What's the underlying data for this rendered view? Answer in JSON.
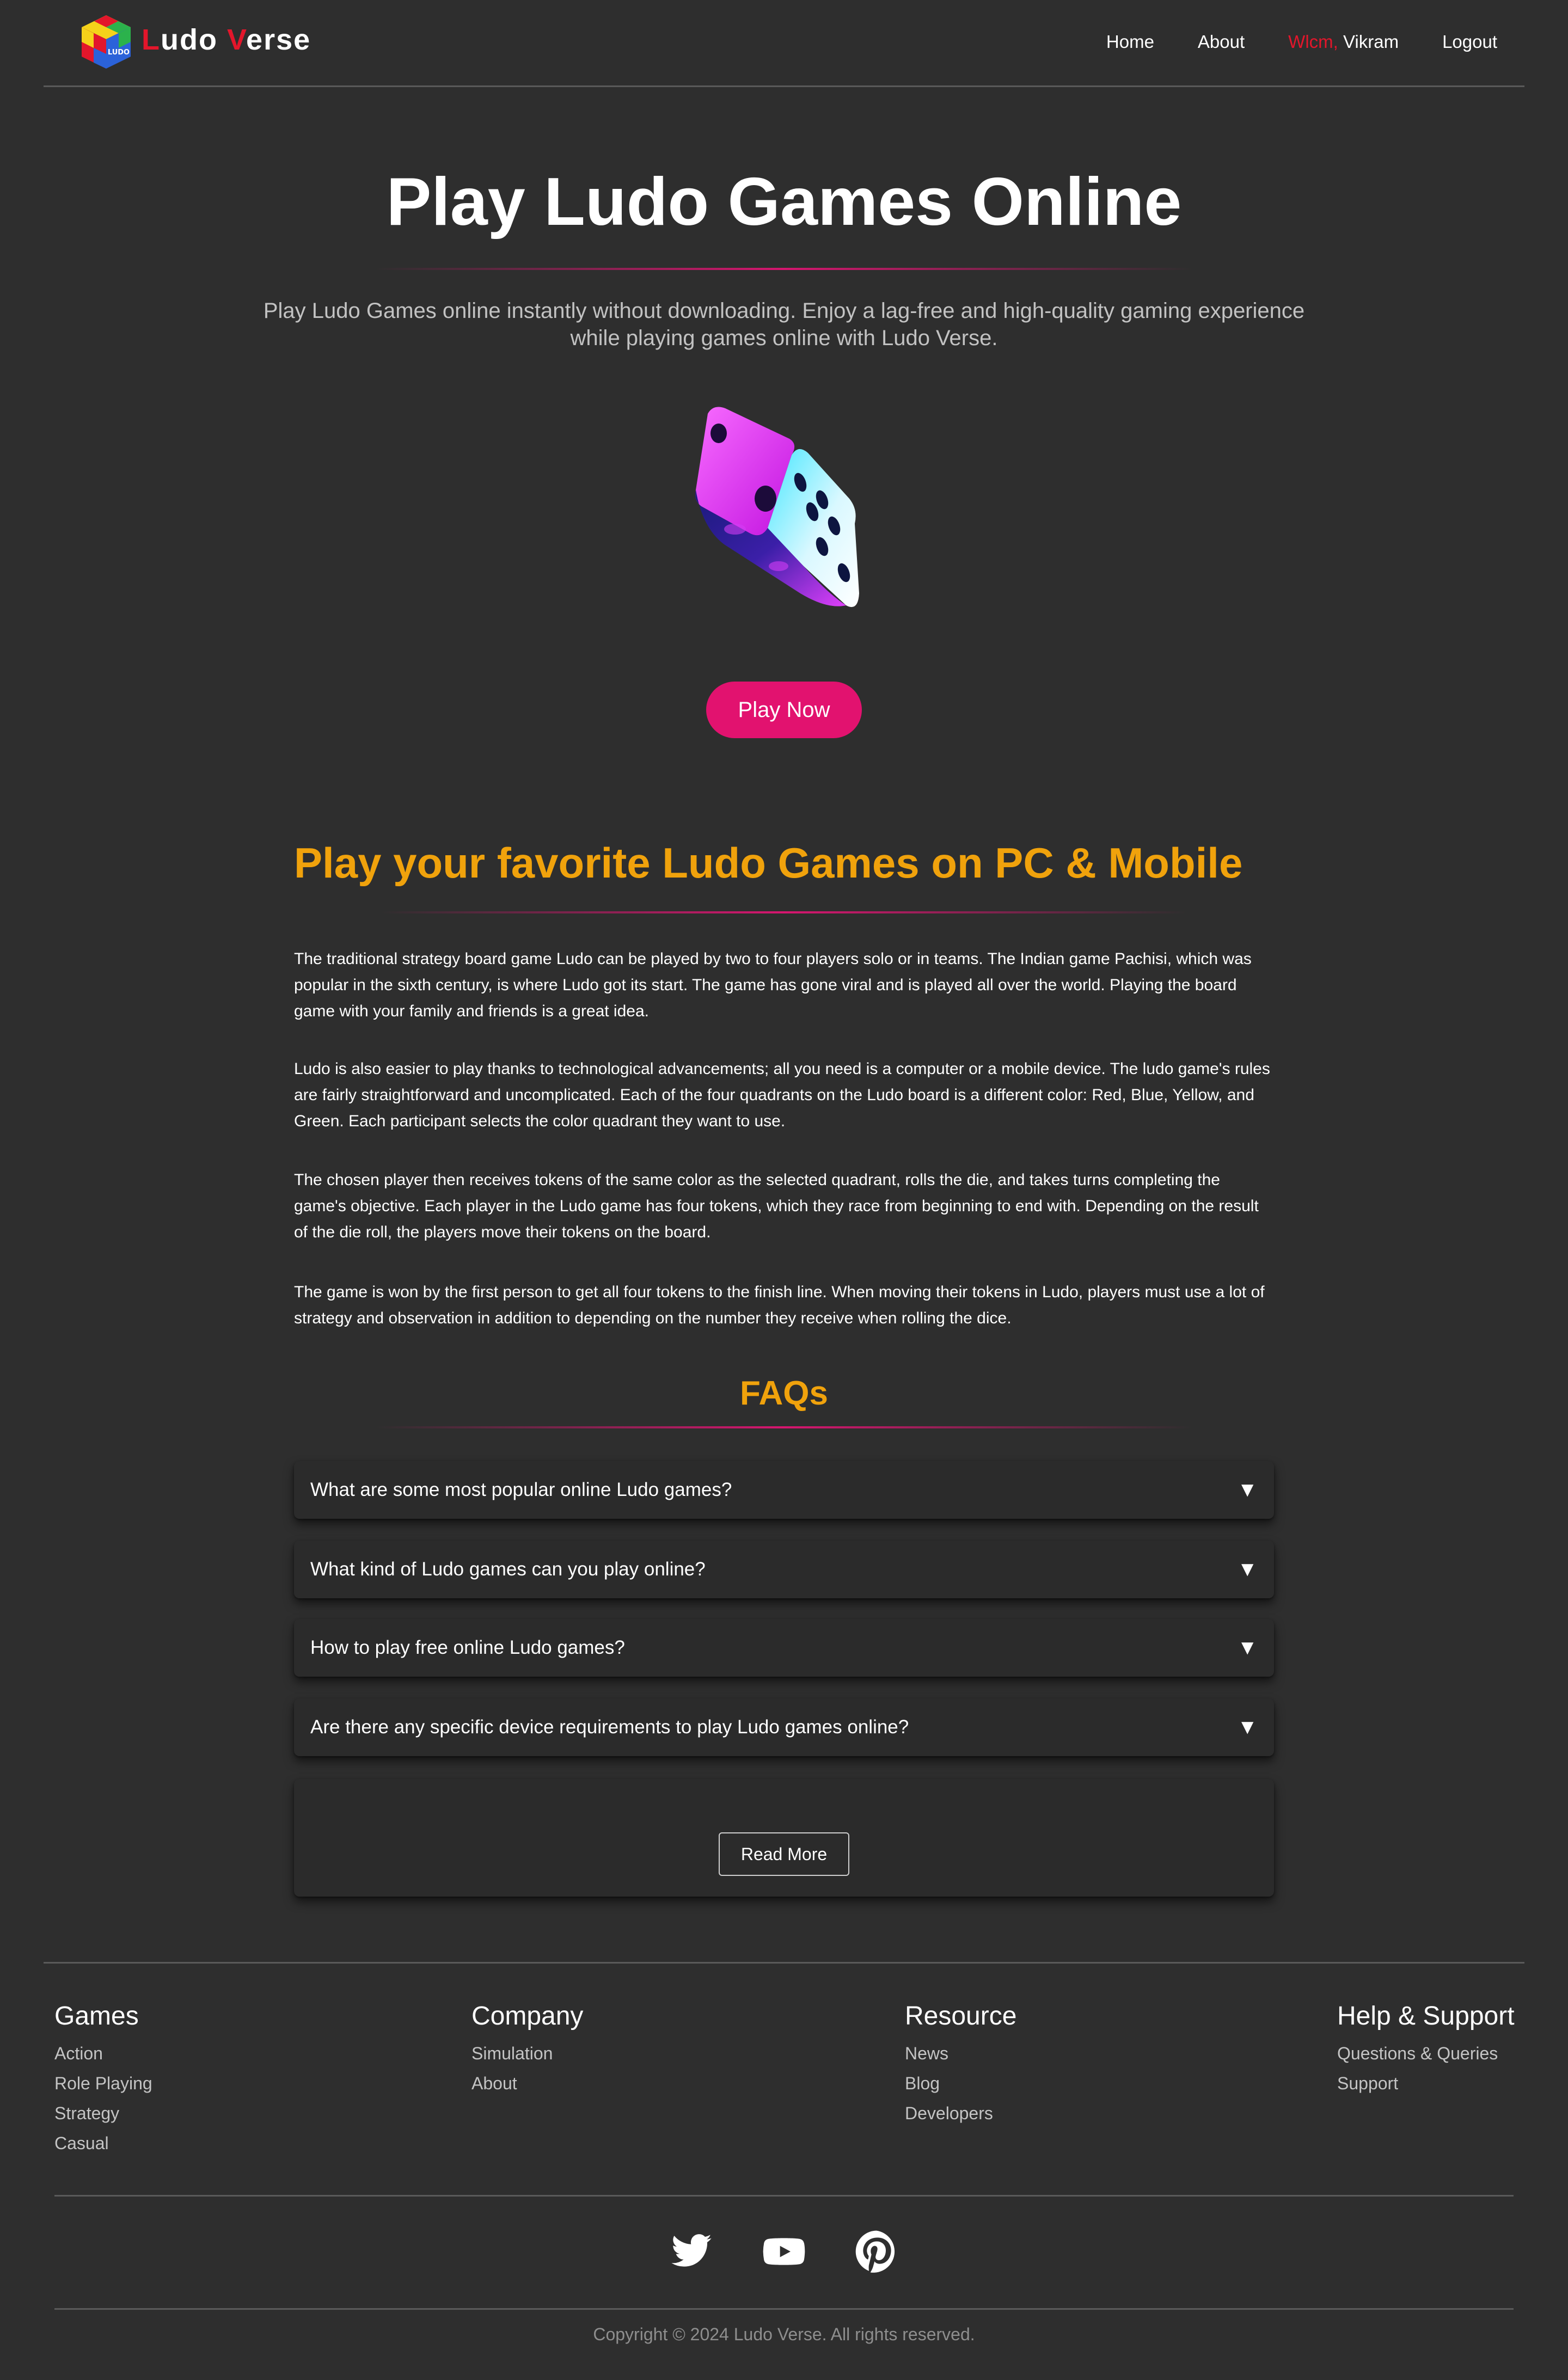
{
  "header": {
    "brand": {
      "first_initial": "L",
      "first_rest": "udo",
      "second_initial": "V",
      "second_rest": "erse"
    },
    "logo_text": "LUDO",
    "nav": {
      "home": "Home",
      "about": "About",
      "welcome_prefix": "Wlcm,",
      "username": "Vikram",
      "logout": "Logout"
    }
  },
  "hero": {
    "title": "Play Ludo Games Online",
    "subtitle": "Play Ludo Games online instantly without downloading. Enjoy a lag-free and high-quality gaming experience while playing games online with Ludo Verse.",
    "play_button": "Play Now"
  },
  "about": {
    "title": "Play your favorite Ludo Games on PC & Mobile",
    "paragraphs": [
      "The traditional strategy board game Ludo can be played by two to four players solo or in teams. The Indian game Pachisi, which was popular in the sixth century, is where Ludo got its start. The game has gone viral and is played all over the world. Playing the board game with your family and friends is a great idea.",
      "Ludo is also easier to play thanks to technological advancements; all you need is a computer or a mobile device. The ludo game's rules are fairly straightforward and uncomplicated. Each of the four quadrants on the Ludo board is a different color: Red, Blue, Yellow, and Green. Each participant selects the color quadrant they want to use.",
      "The chosen player then receives tokens of the same color as the selected quadrant, rolls the die, and takes turns completing the game's objective. Each player in the Ludo game has four tokens, which they race from beginning to end with. Depending on the result of the die roll, the players move their tokens on the board.",
      "The game is won by the first person to get all four tokens to the finish line. When moving their tokens in Ludo, players must use a lot of strategy and observation in addition to depending on the number they receive when rolling the dice."
    ]
  },
  "faq": {
    "title": "FAQs",
    "items": [
      {
        "question": "What are some most popular online Ludo games?",
        "arrow": "▼"
      },
      {
        "question": "What kind of Ludo games can you play online?",
        "arrow": "▼"
      },
      {
        "question": "How to play free online Ludo games?",
        "arrow": "▼"
      },
      {
        "question": "Are there any specific device requirements to play Ludo games online?",
        "arrow": "▼"
      }
    ],
    "read_more": "Read More"
  },
  "footer": {
    "columns": [
      {
        "heading": "Games",
        "links": [
          "Action",
          "Role Playing",
          "Strategy",
          "Casual"
        ]
      },
      {
        "heading": "Company",
        "links": [
          "Simulation",
          "About"
        ]
      },
      {
        "heading": "Resource",
        "links": [
          "News",
          "Blog",
          "Developers"
        ]
      },
      {
        "heading": "Help & Support",
        "links": [
          "Questions & Queries",
          "Support"
        ]
      }
    ],
    "social": [
      "twitter-icon",
      "youtube-icon",
      "pinterest-icon"
    ],
    "copyright": "Copyright © 2024 Ludo Verse. All rights reserved."
  },
  "colors": {
    "background": "#2e2e2e",
    "accent_pink": "#e2126f",
    "accent_orange": "#f0a20c",
    "brand_red": "#e3162b"
  }
}
